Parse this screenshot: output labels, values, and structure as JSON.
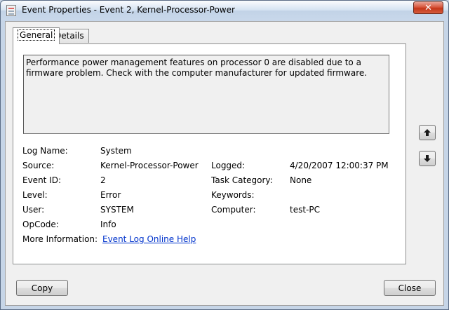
{
  "window": {
    "title": "Event Properties - Event 2, Kernel-Processor-Power",
    "close_glyph": "✕"
  },
  "tabs": [
    {
      "label": "General",
      "active": true
    },
    {
      "label": "Details",
      "active": false
    }
  ],
  "description": "Performance power management features on processor 0 are disabled due to a firmware problem. Check with the computer manufacturer for updated firmware.",
  "fields": {
    "log_name": {
      "label": "Log Name:",
      "value": "System"
    },
    "source": {
      "label": "Source:",
      "value": "Kernel-Processor-Power"
    },
    "event_id": {
      "label": "Event ID:",
      "value": "2"
    },
    "level": {
      "label": "Level:",
      "value": "Error"
    },
    "user": {
      "label": "User:",
      "value": "SYSTEM"
    },
    "opcode": {
      "label": "OpCode:",
      "value": "Info"
    },
    "more_info": {
      "label": "More Information:",
      "link": "Event Log Online Help"
    },
    "logged": {
      "label": "Logged:",
      "value": "4/20/2007 12:00:37 PM"
    },
    "task_category": {
      "label": "Task Category:",
      "value": "None"
    },
    "keywords": {
      "label": "Keywords:",
      "value": ""
    },
    "computer": {
      "label": "Computer:",
      "value": "test-PC"
    }
  },
  "buttons": {
    "copy": "Copy",
    "close": "Close"
  },
  "icons": {
    "up": "arrow-up-icon",
    "down": "arrow-down-icon"
  },
  "colors": {
    "link": "#0033cc",
    "close_button": "#c4361a"
  }
}
